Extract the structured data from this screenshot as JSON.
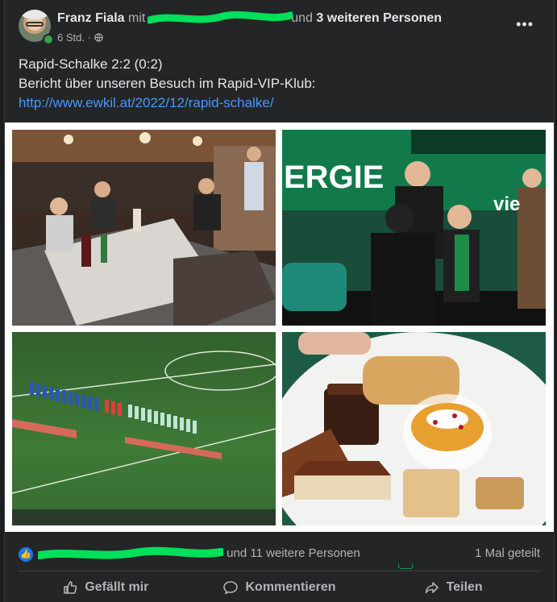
{
  "post": {
    "author": "Franz Fiala",
    "with_word": "mit",
    "and_word": "und",
    "others": "3 weiteren Personen",
    "time": "6 Std. ·",
    "line1": "Rapid-Schalke 2:2 (0:2)",
    "line2": "Bericht über unseren Besuch im Rapid-VIP-Klub:",
    "link": "http://www.ewkil.at/2022/12/rapid-schalke/"
  },
  "photos": {
    "p2_banner": "ERGIE",
    "p2_banner_right": "vie"
  },
  "reactions": {
    "suffix": "und 11 weitere Personen",
    "shares": "1 Mal geteilt"
  },
  "actions": {
    "like": "Gefällt mir",
    "comment": "Kommentieren",
    "share": "Teilen"
  },
  "colors": {
    "accent": "#1877f2",
    "link": "#4599ff",
    "scribble": "#00e05a"
  },
  "icons": [
    "globe-icon",
    "more-icon",
    "like-icon",
    "comment-icon",
    "share-icon"
  ]
}
